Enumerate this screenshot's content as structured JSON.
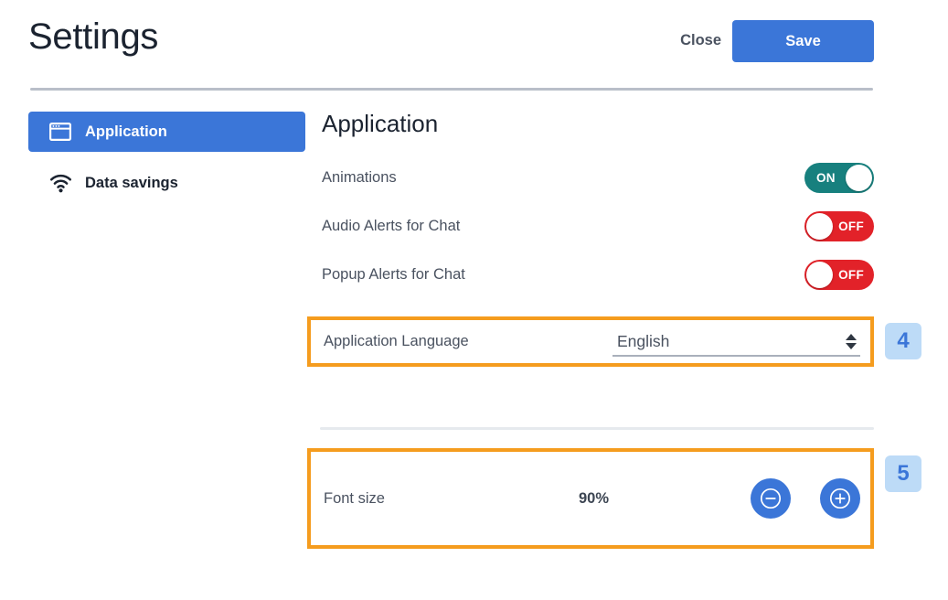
{
  "header": {
    "title": "Settings",
    "close_label": "Close",
    "save_label": "Save"
  },
  "sidebar": {
    "items": [
      {
        "label": "Application",
        "icon": "window-icon",
        "active": true
      },
      {
        "label": "Data savings",
        "icon": "wifi-icon",
        "active": false
      }
    ]
  },
  "main": {
    "section_title": "Application",
    "toggles": [
      {
        "label": "Animations",
        "state": "ON"
      },
      {
        "label": "Audio Alerts for Chat",
        "state": "OFF"
      },
      {
        "label": "Popup Alerts for Chat",
        "state": "OFF"
      }
    ],
    "language": {
      "label": "Application Language",
      "value": "English"
    },
    "font_size": {
      "label": "Font size",
      "value": "90%",
      "decrease_glyph": "⊖",
      "increase_glyph": "⊕"
    }
  },
  "annotations": [
    {
      "number": "4"
    },
    {
      "number": "5"
    }
  ],
  "colors": {
    "accent_blue": "#3b76d8",
    "toggle_on_teal": "#17807e",
    "toggle_off_red": "#e22229",
    "highlight_orange": "#f59c1e",
    "badge_bg": "#bddbf7"
  }
}
